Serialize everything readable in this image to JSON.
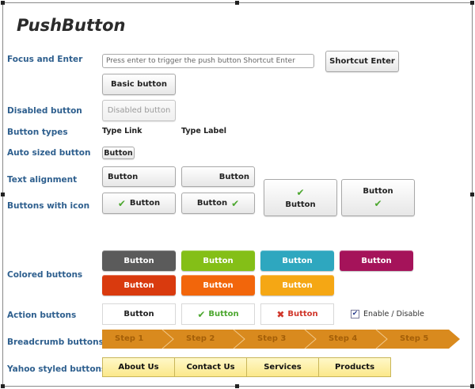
{
  "title": "PushButton",
  "labels": {
    "focus": "Focus and Enter",
    "disabled": "Disabled button",
    "types": "Button types",
    "auto_sized": "Auto sized button",
    "text_alignment": "Text alignment",
    "with_icon": "Buttons with icon",
    "colored": "Colored buttons",
    "action": "Action buttons",
    "breadcrumb": "Breadcrumb buttons",
    "yahoo": "Yahoo styled buttons"
  },
  "focus": {
    "input_placeholder": "Press enter to trigger the push button Shortcut Enter",
    "shortcut_label": "Shortcut Enter",
    "basic_label": "Basic button"
  },
  "disabled_label": "Disabled button",
  "types": {
    "link": "Type Link",
    "label": "Type Label"
  },
  "auto_sized_label": "Button",
  "alignment": {
    "left": "Button",
    "right": "Button"
  },
  "icon_buttons": [
    "Button",
    "Button",
    "Button",
    "Button"
  ],
  "colored": [
    {
      "label": "Button",
      "color": "#5b5b5b"
    },
    {
      "label": "Button",
      "color": "#84bf17"
    },
    {
      "label": "Button",
      "color": "#2ea7bf"
    },
    {
      "label": "Button",
      "color": "#a5135a"
    },
    {
      "label": "Button",
      "color": "#d93a0e"
    },
    {
      "label": "Button",
      "color": "#f2660b"
    },
    {
      "label": "Button",
      "color": "#f5a714"
    }
  ],
  "action": {
    "plain": "Button",
    "ok": "Button",
    "cancel": "Button",
    "toggle_label": "Enable / Disable",
    "toggle_checked": true,
    "ok_color": "#4ca72f",
    "cancel_color": "#d0362a"
  },
  "breadcrumb": {
    "steps": [
      "Step 1",
      "Step 2",
      "Step 3",
      "Step 4",
      "Step 5"
    ],
    "color": "#d98a1e"
  },
  "yahoo": [
    "About Us",
    "Contact Us",
    "Services",
    "Products"
  ]
}
